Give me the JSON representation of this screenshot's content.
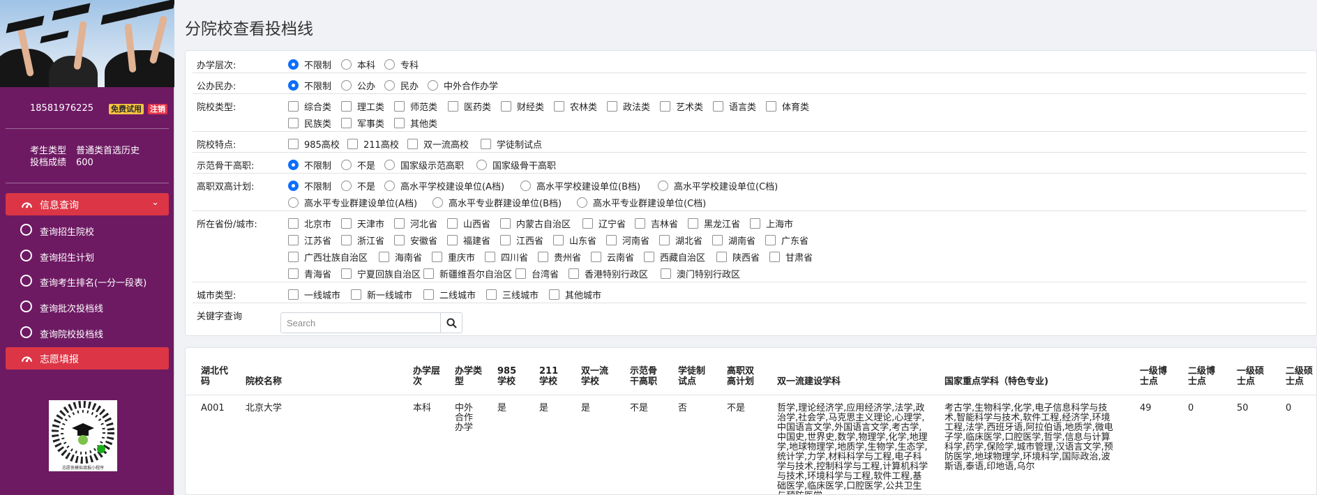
{
  "sidebar": {
    "phone": "18581976225",
    "trial_badge": "免费试用",
    "logout_badge": "注销",
    "candidate_type_label": "考生类型",
    "candidate_type_value": "普通类首选历史",
    "score_label": "投档成绩",
    "score_value": "600",
    "menu": {
      "info_query": "信息查询",
      "sub_items": [
        "查询招生院校",
        "查询招生计划",
        "查询考生排名(一分一段表)",
        "查询批次投档线",
        "查询院校投档线"
      ],
      "volunteer": "志愿填报"
    },
    "qr_caption": "志愿侠模拟填报小程序"
  },
  "page_title": "分院校查看投档线",
  "filters": {
    "level": {
      "label": "办学层次:",
      "options": [
        "不限制",
        "本科",
        "专科"
      ],
      "selected": "不限制"
    },
    "ownership": {
      "label": "公办民办:",
      "options": [
        "不限制",
        "公办",
        "民办",
        "中外合作办学"
      ],
      "selected": "不限制"
    },
    "school_type": {
      "label": "院校类型:",
      "options": [
        "综合类",
        "理工类",
        "师范类",
        "医药类",
        "财经类",
        "农林类",
        "政法类",
        "艺术类",
        "语言类",
        "体育类",
        "民族类",
        "军事类",
        "其他类"
      ]
    },
    "features": {
      "label": "院校特点:",
      "options": [
        "985高校",
        "211高校",
        "双一流高校",
        "学徒制试点"
      ]
    },
    "model_vocational": {
      "label": "示范骨干高职:",
      "options": [
        "不限制",
        "不是",
        "国家级示范高职",
        "国家级骨干高职"
      ],
      "selected": "不限制"
    },
    "double_high": {
      "label": "高职双高计划:",
      "options": [
        "不限制",
        "不是",
        "高水平学校建设单位(A档)",
        "高水平学校建设单位(B档)",
        "高水平学校建设单位(C档)",
        "高水平专业群建设单位(A档)",
        "高水平专业群建设单位(B档)",
        "高水平专业群建设单位(C档)"
      ],
      "selected": "不限制"
    },
    "province": {
      "label": "所在省份/城市:",
      "options": [
        "北京市",
        "天津市",
        "河北省",
        "山西省",
        "内蒙古自治区",
        "辽宁省",
        "吉林省",
        "黑龙江省",
        "上海市",
        "江苏省",
        "浙江省",
        "安徽省",
        "福建省",
        "江西省",
        "山东省",
        "河南省",
        "湖北省",
        "湖南省",
        "广东省",
        "广西壮族自治区",
        "海南省",
        "重庆市",
        "四川省",
        "贵州省",
        "云南省",
        "西藏自治区",
        "陕西省",
        "甘肃省",
        "青海省",
        "宁夏回族自治区",
        "新疆维吾尔自治区",
        "台湾省",
        "香港特别行政区",
        "澳门特别行政区"
      ]
    },
    "city_type": {
      "label": "城市类型:",
      "options": [
        "一线城市",
        "新一线城市",
        "二线城市",
        "三线城市",
        "其他城市"
      ]
    },
    "keyword": {
      "label": "关键字查询",
      "placeholder": "Search"
    }
  },
  "table": {
    "headers": [
      "湖北代码",
      "院校名称",
      "办学层次",
      "办学类型",
      "985学校",
      "211学校",
      "双一流学校",
      "示范骨干高职",
      "学徒制试点",
      "高职双高计划",
      "双一流建设学科",
      "国家重点学科（特色专业)",
      "一级博士点",
      "二级博士点",
      "一级硕士点",
      "二级硕士点"
    ],
    "rows": [
      {
        "code": "A001",
        "name": "北京大学",
        "level": "本科",
        "type": "中外合作办学",
        "is985": "是",
        "is211": "是",
        "double_first": "是",
        "model": "不是",
        "apprentice": "否",
        "double_high": "不是",
        "disciplines": "哲学,理论经济学,应用经济学,法学,政治学,社会学,马克思主义理论,心理学,中国语言文学,外国语言文学,考古学,中国史,世界史,数学,物理学,化学,地理学,地球物理学,地质学,生物学,生态学,统计学,力学,材料科学与工程,电子科学与技术,控制科学与工程,计算机科学与技术,环境科学与工程,软件工程,基础医学,临床医学,口腔医学,公共卫生与预防医学",
        "key_disciplines": "考古学,生物科学,化学,电子信息科学与技术,智能科学与技术,软件工程,经济学,环境工程,法学,西班牙语,阿拉伯语,地质学,微电子学,临床医学,口腔医学,哲学,信息与计算科学,药学,保险学,城市管理,汉语言文学,预防医学,地球物理学,环境科学,国际政治,波斯语,泰语,印地语,乌尔",
        "phd1": "49",
        "phd2": "0",
        "master1": "50",
        "master2": "0"
      }
    ]
  }
}
